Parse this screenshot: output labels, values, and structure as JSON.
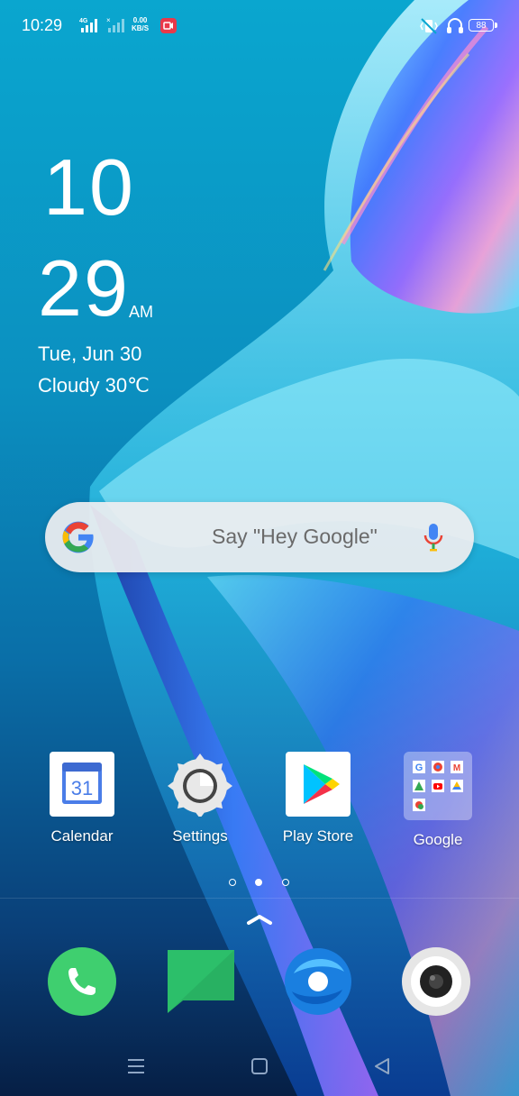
{
  "status_bar": {
    "time": "10:29",
    "net_type": "4G",
    "speed_value": "0.00",
    "speed_unit": "KB/S",
    "battery": "88"
  },
  "clock": {
    "hour": "10",
    "minute": "29",
    "ampm": "AM",
    "date": "Tue, Jun 30",
    "weather": "Cloudy 30℃"
  },
  "search": {
    "hint": "Say \"Hey Google\""
  },
  "apps": [
    {
      "label": "Calendar",
      "icon": "calendar-icon",
      "badge": "31"
    },
    {
      "label": "Settings",
      "icon": "settings-gear-icon"
    },
    {
      "label": "Play Store",
      "icon": "play-store-icon"
    },
    {
      "label": "Google",
      "icon": "google-folder-icon"
    }
  ],
  "page_indicator": {
    "pages": 3,
    "current": 2
  },
  "dock": [
    {
      "name": "phone",
      "icon": "phone-icon"
    },
    {
      "name": "messages",
      "icon": "messages-icon"
    },
    {
      "name": "browser",
      "icon": "browser-icon"
    },
    {
      "name": "camera",
      "icon": "camera-icon"
    }
  ],
  "navigation": [
    "menu",
    "home",
    "back"
  ],
  "colors": {
    "accent": "#0aa6cf",
    "phone_green": "#3fcf6f",
    "messages_green": "#2cbf6a",
    "browser_blue": "#1a7fe0"
  }
}
